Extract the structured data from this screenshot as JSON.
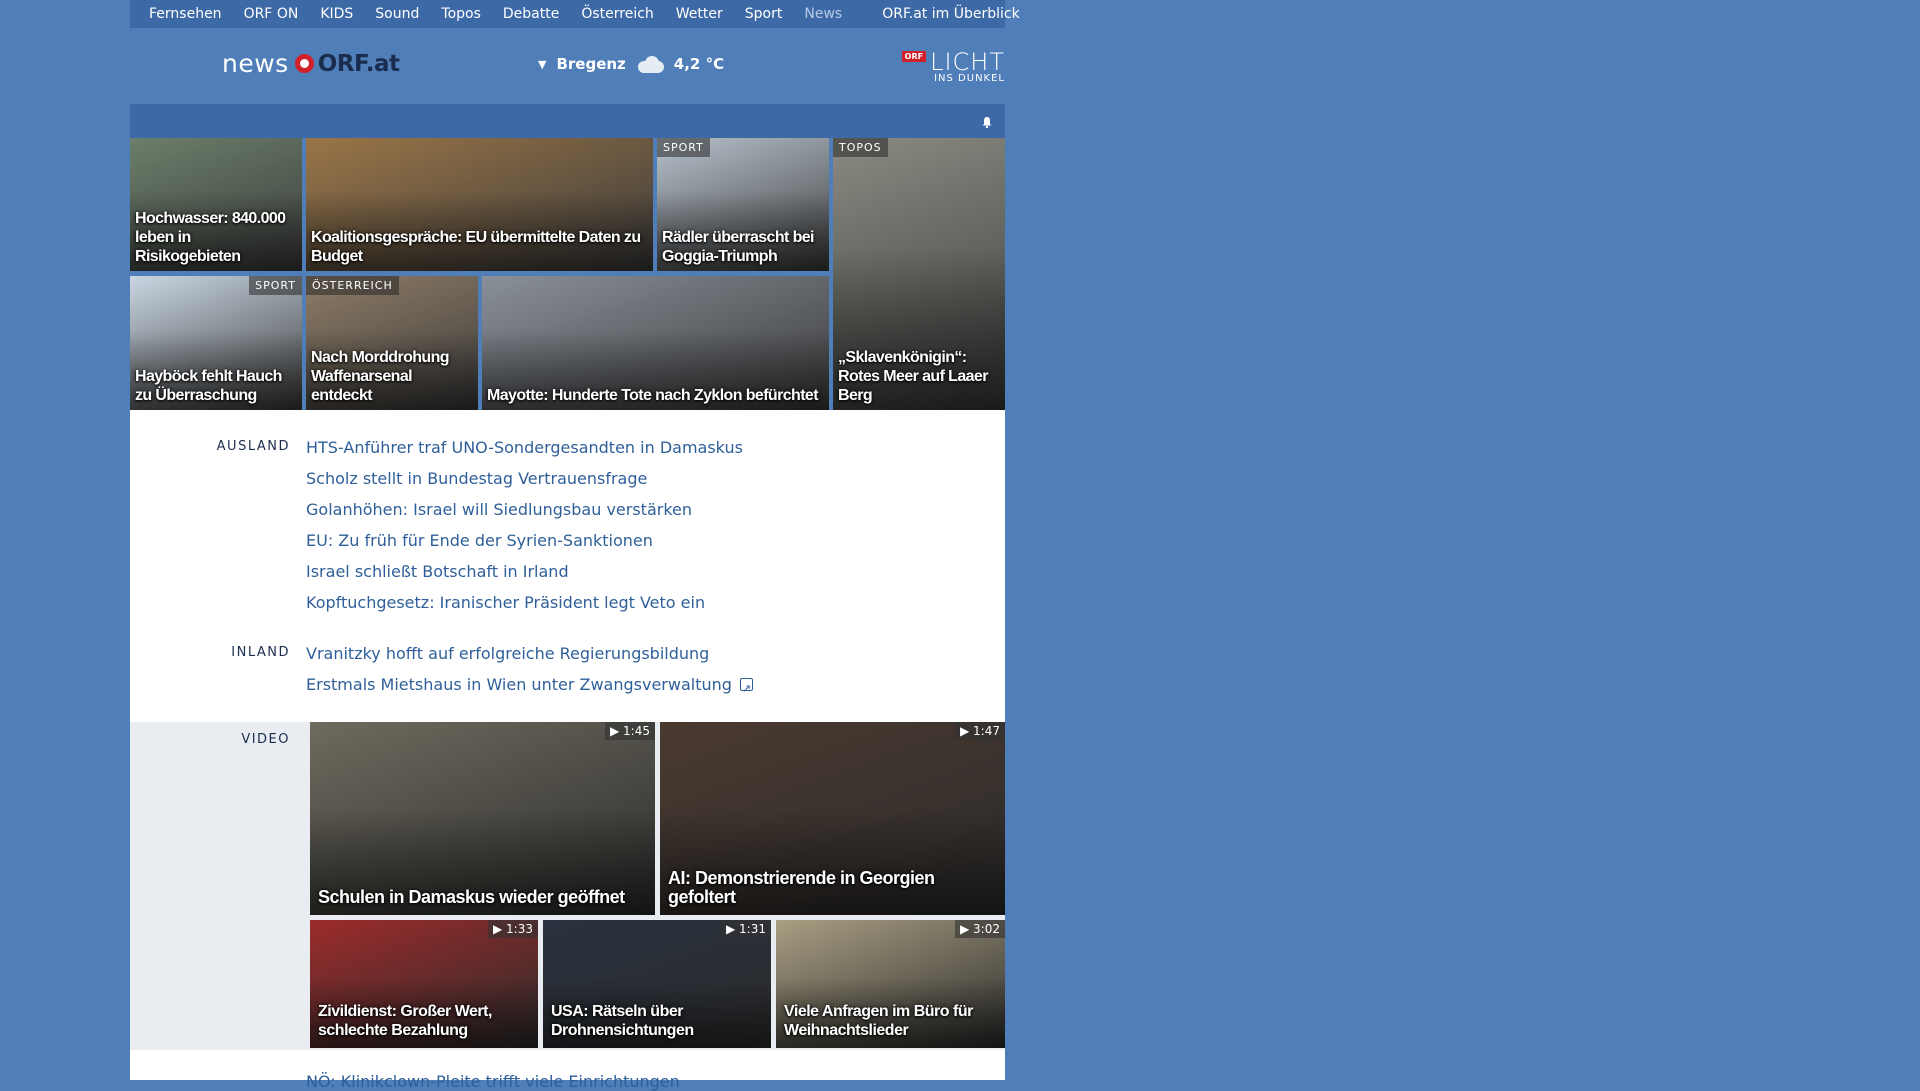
{
  "topnav": {
    "items": [
      "Fernsehen",
      "ORF ON",
      "KIDS",
      "Sound",
      "Topos",
      "Debatte",
      "Österreich",
      "Wetter",
      "Sport",
      "News"
    ],
    "active": "News",
    "overview": "ORF.at im Überblick"
  },
  "header": {
    "logo_news": "news",
    "logo_orf": "ORF.at",
    "weather_city": "Bregenz",
    "weather_temp": "4,2 °C",
    "campaign_badge": "ORF",
    "campaign_big": "LICHT",
    "campaign_small": "INS DUNKEL"
  },
  "tiles": [
    {
      "title": "Hochwasser: 840.000 leben in Risikogebieten",
      "tag": "",
      "bg": "#6b7f6a"
    },
    {
      "title": "Koalitionsgespräche: EU übermittelte Daten zu Budget",
      "tag": "",
      "bg": "#9a7547"
    },
    {
      "title": "Rädler überrascht bei Goggia-Triumph",
      "tag": "SPORT",
      "bg": "#b7c2cc"
    },
    {
      "title": "„Sklavenkönigin“: Rotes Meer auf Laaer Berg",
      "tag": "TOPOS",
      "bg": "#8b8b83"
    },
    {
      "title": "Hayböck fehlt Hauch zu Überraschung",
      "tag": "SPORT",
      "bg": "#c9d6e2"
    },
    {
      "title": "Nach Morddrohung Waffenarsenal entdeckt",
      "tag": "ÖSTERREICH",
      "bg": "#8e7c66"
    },
    {
      "title": "Mayotte: Hunderte Tote nach Zyklon befürchtet",
      "tag": "",
      "bg": "#8a9099"
    }
  ],
  "ausland": {
    "label": "AUSLAND",
    "links": [
      "HTS-Anführer traf UNO-Sondergesandten in Damaskus",
      "Scholz stellt in Bundestag Vertrauensfrage",
      "Golanhöhen: Israel will Siedlungsbau verstärken",
      "EU: Zu früh für Ende der Syrien-Sanktionen",
      "Israel schließt Botschaft in Irland",
      "Kopftuchgesetz: Iranischer Präsident legt Veto ein"
    ]
  },
  "inland": {
    "label": "INLAND",
    "links": [
      "Vranitzky hofft auf erfolgreiche Regierungsbildung",
      "Erstmals Mietshaus in Wien unter Zwangsverwaltung"
    ]
  },
  "video": {
    "label": "VIDEO",
    "items": [
      {
        "title": "Schulen in Damaskus wieder geöffnet",
        "duration": "1:45",
        "bg": "#6e6a5e"
      },
      {
        "title": "AI: Demonstrierende in Georgien gefoltert",
        "duration": "1:47",
        "bg": "#4a3a30"
      },
      {
        "title": "Zivildienst: Großer Wert, schlechte Bezahlung",
        "duration": "1:33",
        "bg": "#9c2b2b"
      },
      {
        "title": "USA: Rätseln über Drohnensichtungen",
        "duration": "1:31",
        "bg": "#2a3240"
      },
      {
        "title": "Viele Anfragen im Büro für Weihnachtslieder",
        "duration": "3:02",
        "bg": "#a89e82"
      }
    ]
  },
  "bottom_peek": "NÖ: Klinikclown-Pleite trifft viele Einrichtungen"
}
